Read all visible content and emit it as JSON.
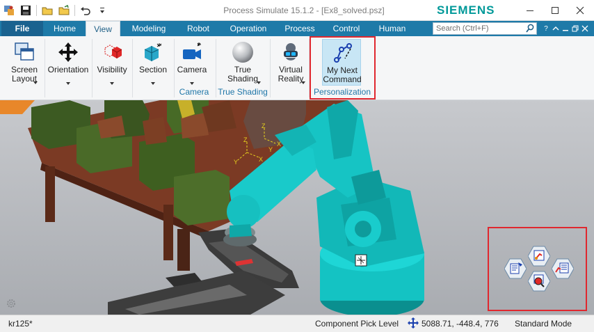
{
  "window": {
    "title": "Process Simulate 15.1.2 - [Ex8_solved.psz]",
    "brand": "SIEMENS",
    "controls": [
      "minimize",
      "maximize",
      "close"
    ]
  },
  "quick_access": {
    "icons": [
      "app-icon",
      "save-icon",
      "open-icon",
      "open-folder-icon",
      "undo-icon",
      "customize-dropdown-icon"
    ]
  },
  "tabs": {
    "file": "File",
    "items": [
      {
        "label": "Home",
        "active": false
      },
      {
        "label": "View",
        "active": true
      },
      {
        "label": "Modeling",
        "active": false
      },
      {
        "label": "Robot",
        "active": false
      },
      {
        "label": "Operation",
        "active": false
      },
      {
        "label": "Process",
        "active": false
      },
      {
        "label": "Control",
        "active": false
      },
      {
        "label": "Human",
        "active": false
      }
    ],
    "search_placeholder": "Search (Ctrl+F)"
  },
  "ribbon": {
    "buttons": {
      "screen_layout": "Screen\nLayout",
      "orientation": "Orientation",
      "visibility": "Visibility",
      "section": "Section",
      "camera": "Camera",
      "true_shading": "True\nShading",
      "virtual_reality": "Virtual\nReality",
      "my_next_command": "My Next\nCommand"
    },
    "groups": {
      "camera": "Camera",
      "true_shading": "True Shading",
      "personalization": "Personalization"
    }
  },
  "viewport": {
    "axis_labels": [
      "Z",
      "X",
      "Y",
      "Z",
      "X",
      "Y"
    ]
  },
  "status": {
    "object": "kr125*",
    "pick_level": "Component Pick Level",
    "coordinates": "5088.71, -448.4, 776",
    "mode": "Standard Mode"
  },
  "colors": {
    "accent": "#1e7aa8",
    "brand": "#009999",
    "highlight": "#e0272e",
    "robot": "#14c3c3"
  }
}
